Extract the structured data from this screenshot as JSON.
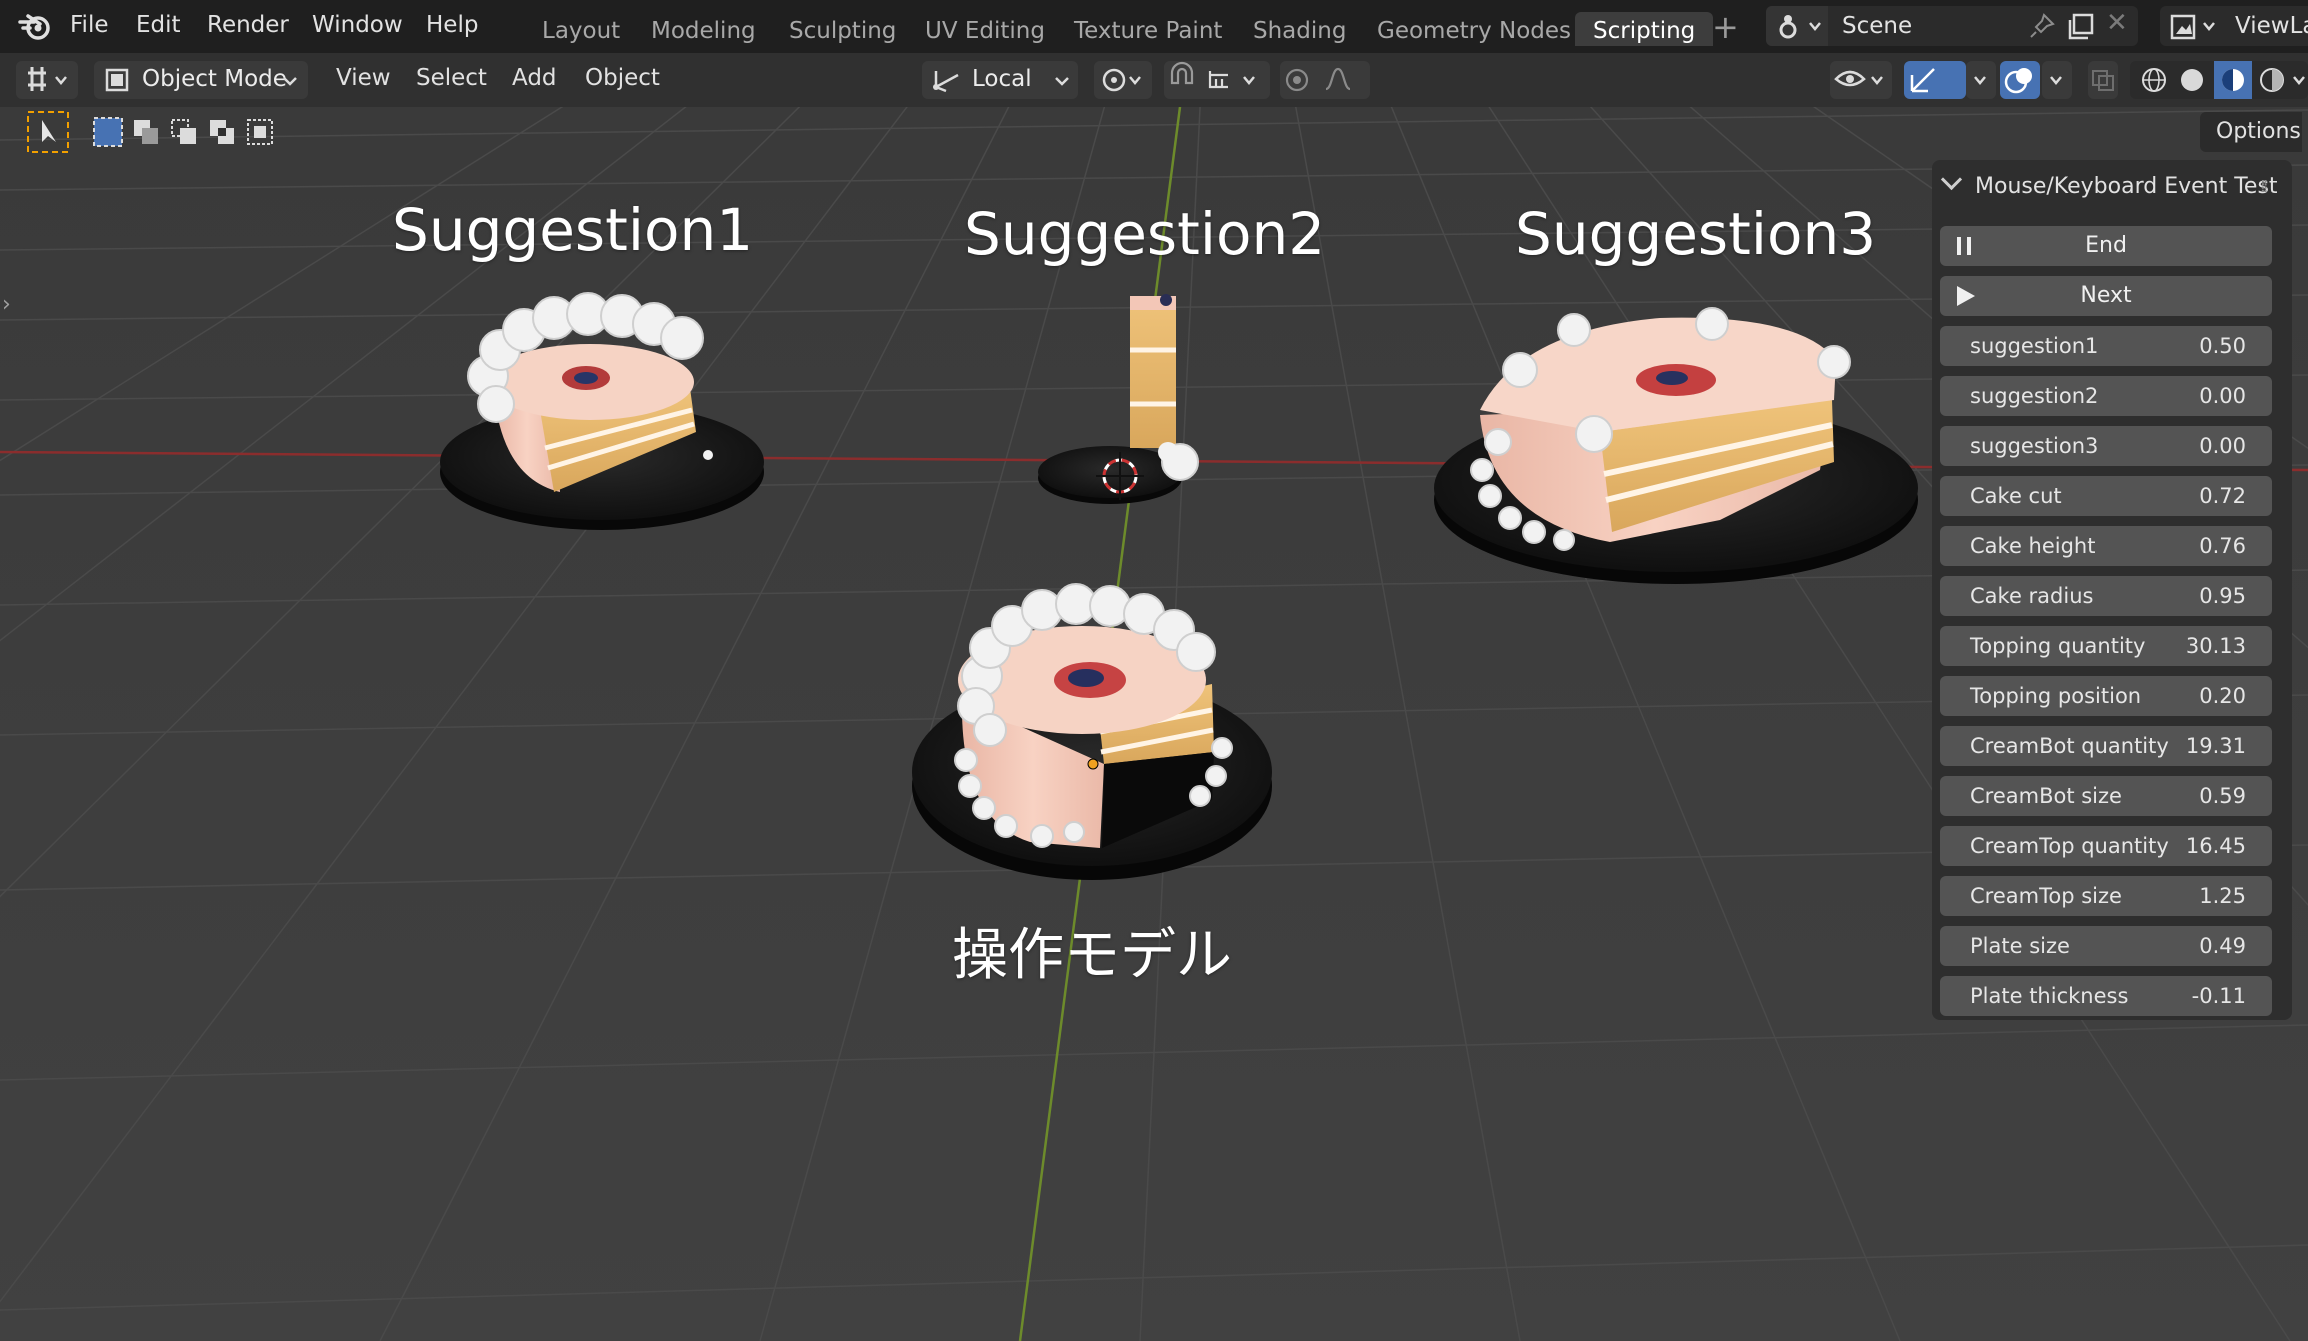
{
  "menu": [
    "File",
    "Edit",
    "Render",
    "Window",
    "Help"
  ],
  "workspaces": [
    "Layout",
    "Modeling",
    "Sculpting",
    "UV Editing",
    "Texture Paint",
    "Shading",
    "Geometry Nodes",
    "Scripting"
  ],
  "active_workspace": "Scripting",
  "scene": {
    "name": "Scene"
  },
  "view_layer": {
    "name": "ViewLa"
  },
  "viewport_header": {
    "mode": "Object Mode",
    "menus": [
      "View",
      "Select",
      "Add",
      "Object"
    ],
    "orientation": "Local",
    "options_label": "Options"
  },
  "viewport_labels": {
    "s1": "Suggestion1",
    "s2": "Suggestion2",
    "s3": "Suggestion3",
    "main": "操作モデル"
  },
  "panel": {
    "title": "Mouse/Keyboard Event Test",
    "end_label": "End",
    "next_label": "Next",
    "params": [
      {
        "label": "suggestion1",
        "value": "0.50"
      },
      {
        "label": "suggestion2",
        "value": "0.00"
      },
      {
        "label": "suggestion3",
        "value": "0.00"
      },
      {
        "label": "Cake cut",
        "value": "0.72"
      },
      {
        "label": "Cake height",
        "value": "0.76"
      },
      {
        "label": "Cake radius",
        "value": "0.95"
      },
      {
        "label": "Topping quantity",
        "value": "30.13"
      },
      {
        "label": "Topping position",
        "value": "0.20"
      },
      {
        "label": "CreamBot quantity",
        "value": "19.31"
      },
      {
        "label": "CreamBot size",
        "value": "0.59"
      },
      {
        "label": "CreamTop quantity",
        "value": "16.45"
      },
      {
        "label": "CreamTop size",
        "value": "1.25"
      },
      {
        "label": "Plate size",
        "value": "0.49"
      },
      {
        "label": "Plate thickness",
        "value": "-0.11"
      }
    ]
  },
  "colors": {
    "top_bar": "#1f1f1f",
    "header": "#303030",
    "viewport_bg": "#3d3d3d",
    "accent_blue": "#4772b3",
    "x_axis": "#8b2d2d",
    "y_axis": "#6d8b2b",
    "cake": "#f3c7b7",
    "sponge": "#e7b86c",
    "plate": "#161616"
  },
  "icons": {
    "logo": "blender-logo-icon",
    "scene_type": "scene-icon",
    "pin": "pin-icon",
    "new_scene": "duplicate-icon",
    "remove_scene": "close-icon",
    "view_layer": "view-layer-icon",
    "end": "pause-icon",
    "next": "play-icon"
  }
}
